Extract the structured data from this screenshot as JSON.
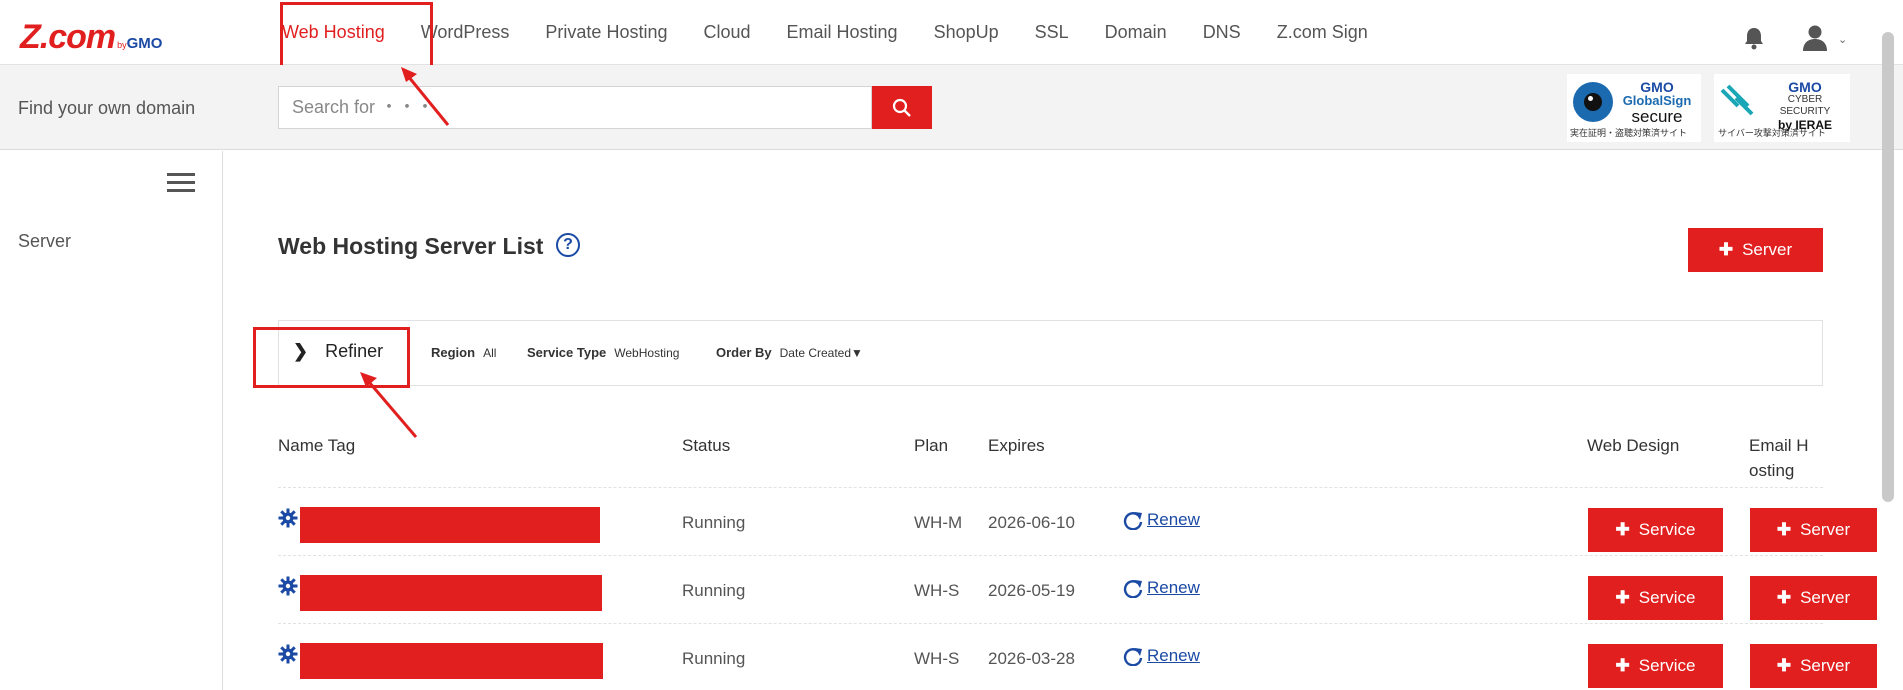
{
  "logo": {
    "main": "Z.com",
    "by": "by",
    "gmo": "GMO"
  },
  "nav": {
    "items": [
      "Web Hosting",
      "WordPress",
      "Private Hosting",
      "Cloud",
      "Email Hosting",
      "ShopUp",
      "SSL",
      "Domain",
      "DNS",
      "Z.com Sign"
    ],
    "active_index": 0
  },
  "search": {
    "label": "Find your own domain",
    "placeholder": "Search for ・・・"
  },
  "badges": {
    "globalsign": {
      "gmo": "GMO",
      "name": "GlobalSign",
      "secure": "secure",
      "caption": "実在証明・盗聴対策済サイト"
    },
    "ierae": {
      "gmo": "GMO",
      "line1": "CYBER SECURITY",
      "line2": "by IERAE",
      "caption": "サイバー攻撃対策済サイト"
    }
  },
  "sidebar": {
    "items": [
      "Server"
    ]
  },
  "main": {
    "title": "Web Hosting Server List",
    "help": "?",
    "add_button": "Server",
    "refiner": {
      "label": "Refiner",
      "filters": [
        {
          "key": "Region",
          "value": "All"
        },
        {
          "key": "Service Type",
          "value": "WebHosting"
        },
        {
          "key": "Order By",
          "value": "Date Created▼"
        }
      ]
    },
    "columns": [
      "Name Tag",
      "Status",
      "Plan",
      "Expires",
      "Web Design",
      "Email H\nosting"
    ],
    "rows": [
      {
        "status": "Running",
        "plan": "WH-M",
        "expires": "2026-06-10",
        "renew": "Renew",
        "web_design": "Service",
        "email_hosting": "Server"
      },
      {
        "status": "Running",
        "plan": "WH-S",
        "expires": "2026-05-19",
        "renew": "Renew",
        "web_design": "Service",
        "email_hosting": "Server"
      },
      {
        "status": "Running",
        "plan": "WH-S",
        "expires": "2026-03-28",
        "renew": "Renew",
        "web_design": "Service",
        "email_hosting": "Server"
      }
    ]
  },
  "colors": {
    "accent": "#e11f1f",
    "link": "#1b4aa5",
    "band": "#f3f3f3"
  }
}
